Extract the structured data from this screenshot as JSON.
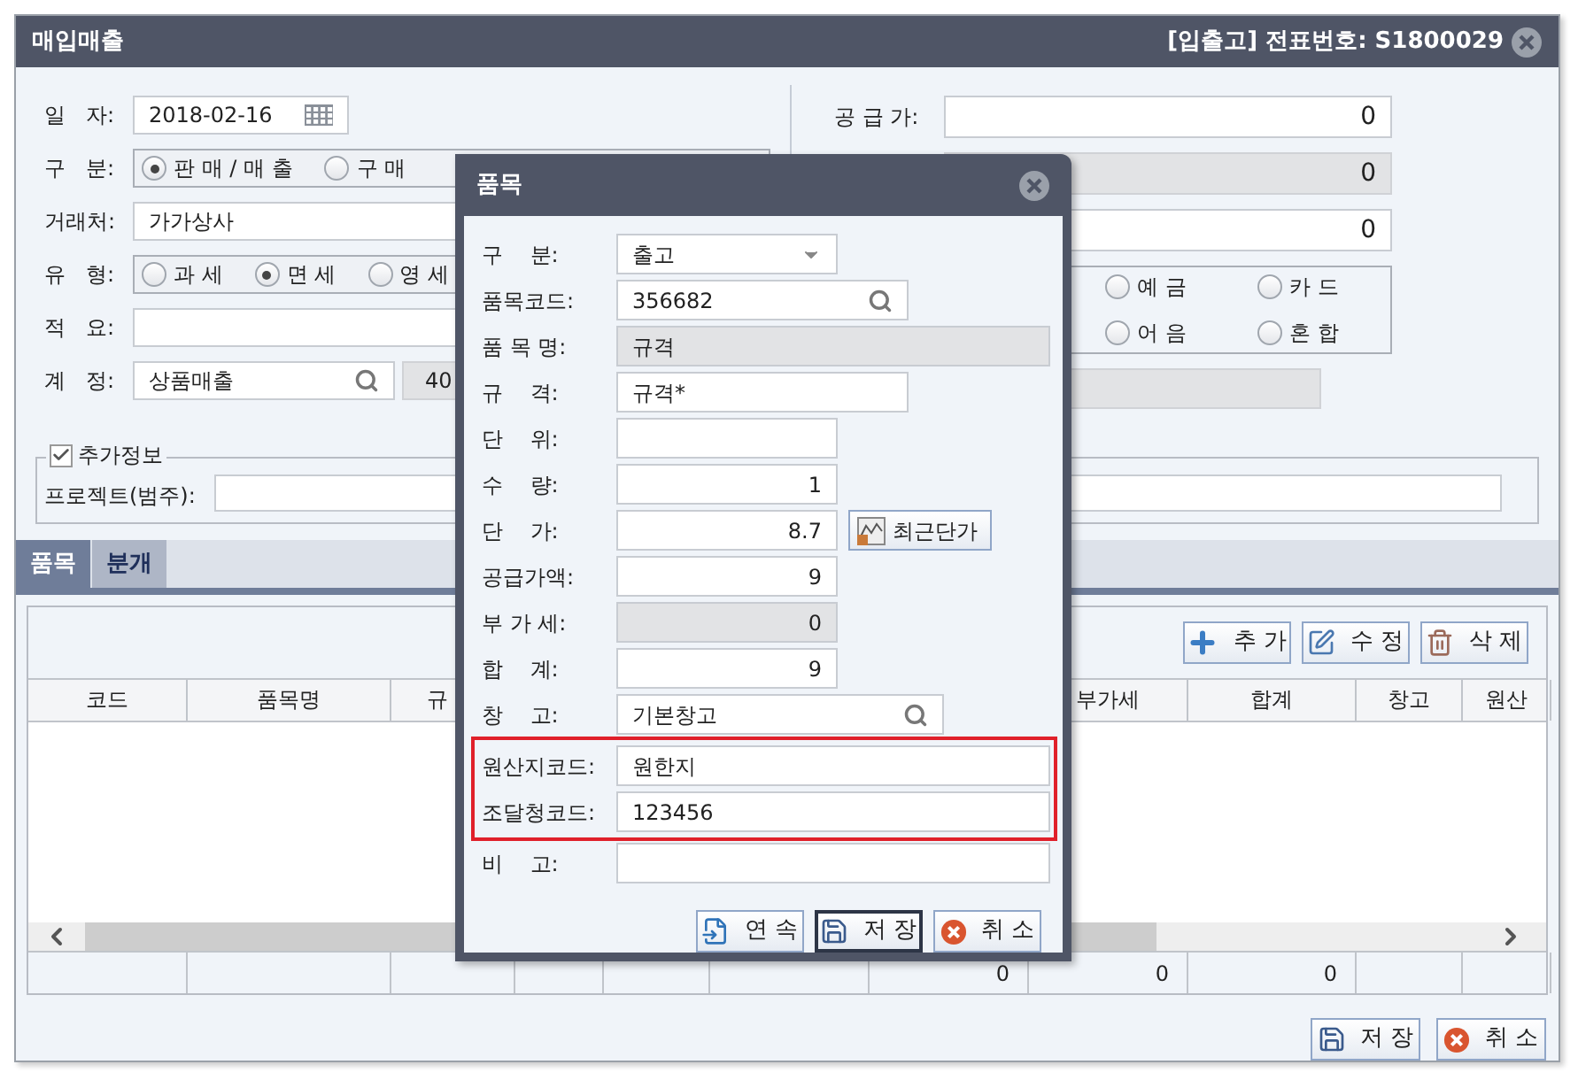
{
  "window": {
    "title": "매입매출",
    "doc_info": "[입출고] 전표번호: S1800029"
  },
  "form_left": [
    {
      "kind": "date",
      "label": "일   자:",
      "value": "2018-02-16"
    },
    {
      "kind": "radio",
      "label": "구   분:",
      "options": [
        {
          "label": "판 매 / 매 출",
          "selected": true
        },
        {
          "label": "구 매",
          "selected": false
        }
      ]
    },
    {
      "kind": "text",
      "label": "거래처:",
      "value": "가가상사"
    },
    {
      "kind": "radio",
      "label": "유   형:",
      "options": [
        {
          "label": "과 세",
          "selected": false
        },
        {
          "label": "면 세",
          "selected": true
        },
        {
          "label": "영 세",
          "selected": false
        }
      ]
    },
    {
      "kind": "text",
      "label": "적   요:"
    },
    {
      "kind": "search",
      "label": "계   정:",
      "value": "상품매출",
      "extra": "40"
    }
  ],
  "form_right": {
    "supply_label": "공 급 가:",
    "supply": "0",
    "row_2": "0",
    "row_3": "0",
    "payment": [
      {
        "label": "예 금",
        "selected": false
      },
      {
        "label": "카 드",
        "selected": false
      },
      {
        "label": "어 음",
        "selected": false
      },
      {
        "label": "혼 합",
        "selected": false
      }
    ]
  },
  "extra_info": {
    "label": "추가정보",
    "checked": true,
    "project_label": "프로젝트(범주):"
  },
  "tabs": [
    {
      "label": "품목",
      "selected": true
    },
    {
      "label": "분개",
      "selected": false
    }
  ],
  "toolbar": [
    {
      "kind": "add",
      "label": "추 가"
    },
    {
      "kind": "edit",
      "label": "수 정"
    },
    {
      "kind": "delete",
      "label": "삭 제"
    }
  ],
  "table": {
    "columns": [
      "코드",
      "품목명",
      "규",
      "부가세",
      "합계",
      "창고",
      "원산"
    ],
    "footer_totals": [
      "0",
      "0",
      "0"
    ]
  },
  "buttons": [
    {
      "kind": "save",
      "label": "저 장"
    },
    {
      "kind": "cancel",
      "label": "취 소"
    }
  ],
  "dialog": {
    "title": "품목",
    "fields": [
      {
        "kind": "select",
        "label": "구    분:",
        "value": "출고"
      },
      {
        "kind": "search",
        "label": "품목코드:",
        "value": "356682"
      },
      {
        "kind": "readonly",
        "label": "품 목 명:",
        "value": "규격"
      },
      {
        "kind": "text",
        "label": "규    격:",
        "value": "규격*"
      },
      {
        "kind": "text",
        "label": "단    위:"
      },
      {
        "kind": "number",
        "label": "수    량:",
        "value": "1"
      },
      {
        "kind": "number",
        "label": "단    가:",
        "value": "8.7",
        "button": "최근단가"
      },
      {
        "kind": "number",
        "label": "공급가액:",
        "value": "9"
      },
      {
        "kind": "number_readonly",
        "label": "부 가 세:",
        "value": "0"
      },
      {
        "kind": "number",
        "label": "합    계:",
        "value": "9"
      },
      {
        "kind": "search",
        "label": "창    고:",
        "value": "기본창고"
      },
      {
        "kind": "text",
        "label": "원산지코드:",
        "value": "원한지",
        "highlighted": true
      },
      {
        "kind": "text",
        "label": "조달청코드:",
        "value": "123456",
        "highlighted": true
      },
      {
        "kind": "text",
        "label": "비    고:"
      }
    ],
    "buttons": [
      {
        "kind": "continue",
        "label": "연 속",
        "focused": false
      },
      {
        "kind": "save",
        "label": "저 장",
        "focused": true
      },
      {
        "kind": "cancel",
        "label": "취 소",
        "focused": false
      }
    ]
  }
}
